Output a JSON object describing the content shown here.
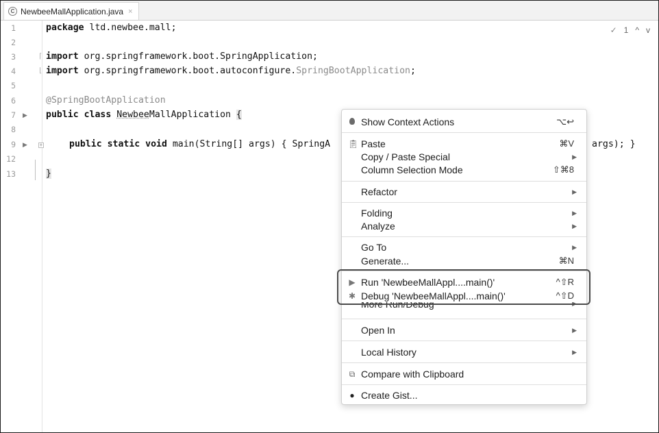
{
  "tab": {
    "icon": "class-icon",
    "icon_letter": "C",
    "title": "NewbeeMallApplication.java",
    "close": "×"
  },
  "inspections": {
    "count": "1",
    "up": "^",
    "down": "v"
  },
  "gutter": {
    "line_numbers": [
      "1",
      "2",
      "3",
      "4",
      "5",
      "6",
      "7",
      "8",
      "9",
      "12",
      "13"
    ]
  },
  "code": {
    "line1_kw": "package",
    "line1_rest": " ltd.newbee.mall;",
    "line3_kw": "import",
    "line3_rest": " org.springframework.boot.SpringApplication;",
    "line4_kw": "import",
    "line4_rest": " org.springframework.boot.autoconfigure.",
    "line4_gray": "SpringBootApplication",
    "line4_end": ";",
    "line6_annot": "@SpringBootApplication",
    "line7_kw": "public class",
    "line7_name_a": "Newbee",
    "line7_name_b": "MallApplication",
    "line7_brace": "{",
    "line9_kw": "public static void",
    "line9_rest": " main(String[] args) { SpringA",
    "line9_tail": "args); }",
    "line13": "}"
  },
  "menu": {
    "show_context_actions": {
      "label": "Show Context Actions",
      "shortcut": "⌥↩",
      "icon": "bulb-icon"
    },
    "paste": {
      "label": "Paste",
      "shortcut": "⌘V",
      "icon": "clipboard-icon"
    },
    "copy_paste_special": {
      "label": "Copy / Paste Special"
    },
    "column_selection": {
      "label": "Column Selection Mode",
      "shortcut": "⇧⌘8"
    },
    "refactor": {
      "label": "Refactor"
    },
    "folding": {
      "label": "Folding"
    },
    "analyze": {
      "label": "Analyze"
    },
    "go_to": {
      "label": "Go To"
    },
    "generate": {
      "label": "Generate...",
      "shortcut": "⌘N"
    },
    "run": {
      "label": "Run 'NewbeeMallAppl....main()'",
      "shortcut": "^⇧R",
      "icon": "run-icon"
    },
    "debug": {
      "label": "Debug 'NewbeeMallAppl....main()'",
      "shortcut": "^⇧D",
      "icon": "debug-icon"
    },
    "more_run": {
      "label": "More Run/Debug"
    },
    "open_in": {
      "label": "Open In"
    },
    "local_history": {
      "label": "Local History"
    },
    "compare_clipboard": {
      "label": "Compare with Clipboard",
      "icon": "compare-icon"
    },
    "create_gist": {
      "label": "Create Gist...",
      "icon": "github-icon"
    },
    "submenu_arrow": "▶"
  }
}
